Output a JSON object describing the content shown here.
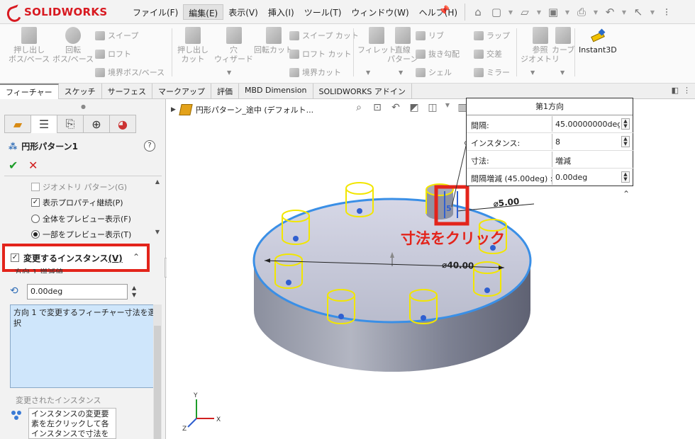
{
  "app": {
    "brand": "SOLIDWORKS",
    "menu": [
      "ファイル(F)",
      "編集(E)",
      "表示(V)",
      "挿入(I)",
      "ツール(T)",
      "ウィンドウ(W)",
      "ヘルプ(H)"
    ],
    "active_menu_index": 1,
    "quick_tools": [
      "home-icon",
      "new-document-icon",
      "open-icon",
      "save-icon",
      "print-icon",
      "undo-icon",
      "select-icon"
    ]
  },
  "commands": {
    "extrude_boss": "押し出し\nボス/ベース",
    "revolve_boss": "回転\nボス/ベース",
    "sweep": "スイープ",
    "loft": "ロフト",
    "boundary_boss": "境界ボス/ベース",
    "extrude_cut": "押し出し\nカット",
    "hole_wizard": "穴\nウィザード",
    "revolve_cut": "回転カット",
    "sweep_cut": "スイープ カット",
    "loft_cut": "ロフト カット",
    "boundary_cut": "境界カット",
    "fillet": "フィレット",
    "linear_pattern": "直線\nパターン",
    "rib": "リブ",
    "draft": "抜き勾配",
    "shell": "シェル",
    "wrap": "ラップ",
    "intersect": "交差",
    "mirror": "ミラー",
    "ref_geometry": "参照\nジオメトリ",
    "curves": "カーブ",
    "instant3d": "Instant3D"
  },
  "tabs": [
    "フィーチャー",
    "スケッチ",
    "サーフェス",
    "マークアップ",
    "評価",
    "MBD Dimension",
    "SOLIDWORKS アドイン"
  ],
  "active_tab_index": 0,
  "property_manager": {
    "title": "円形パターン1",
    "help": "?",
    "ok": "✔",
    "cancel": "✕",
    "options": {
      "geometry_pattern": "ジオメトリ パターン(G)",
      "propagate_visual": "表示プロパティ継続(P)",
      "full_preview": "全体をプレビュー表示(F)",
      "partial_preview": "一部をプレビュー表示(T)"
    },
    "variation": {
      "section_title": "変更するインスタンス",
      "section_key": "(V)",
      "increment_label": "方向 1 増減値",
      "increment_value": "0.00deg",
      "selection_hint": "方向 1 で変更するフィーチャー寸法を選択",
      "changed_label": "変更されたインスタンス",
      "changed_hint": "インスタンスの変更要素を左クリックして各インスタンスで寸法を上書きします。"
    }
  },
  "viewport": {
    "breadcrumb": "円形パターン_途中  (デフォルト...",
    "dim_small": "⌀5.00",
    "dim_large": "⌀40.00",
    "callout": "寸法をクリック",
    "triad": {
      "x": "X",
      "y": "Y",
      "z": "Z"
    }
  },
  "popup": {
    "title": "第1方向",
    "rows": [
      {
        "key": "間隔:",
        "value": "45.00000000deg"
      },
      {
        "key": "インスタンス:",
        "value": "8"
      },
      {
        "key": "寸法:",
        "value": "増減"
      },
      {
        "key": "間隔増減 (45.00deg) :",
        "value": "0.00deg"
      }
    ]
  },
  "colors": {
    "accent_red": "#e3241b",
    "brand_red": "#d81920",
    "selection_blue": "#cfe6fb",
    "highlight_blue": "#3a8fe6",
    "preview_yellow": "#f2e600"
  }
}
